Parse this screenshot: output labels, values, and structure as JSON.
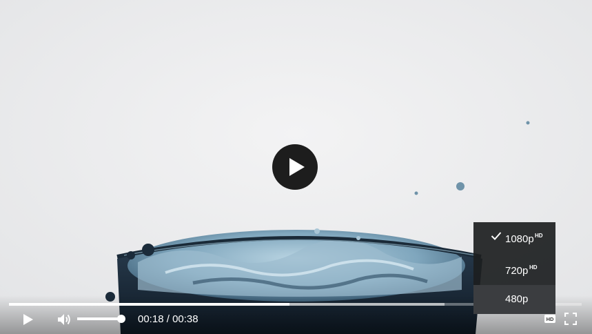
{
  "player": {
    "current_time": "00:18",
    "separator": "/",
    "duration": "00:38",
    "played_fraction": 0.49,
    "buffered_fraction": 0.76,
    "volume_fraction": 1.0
  },
  "quality_menu": {
    "options": [
      {
        "label": "1080p",
        "badge": "HD",
        "selected": true
      },
      {
        "label": "720p",
        "badge": "HD",
        "selected": false
      },
      {
        "label": "480p",
        "badge": "",
        "selected": false
      }
    ]
  },
  "icons": {
    "big_play": "play-icon",
    "play": "play-icon",
    "volume": "volume-icon",
    "quality": "hd-icon",
    "fullscreen": "fullscreen-icon",
    "check": "check-icon"
  },
  "colors": {
    "controls": "#ffffff",
    "menu_bg": "#1c1e20",
    "menu_hover": "#3b3d40",
    "big_play_bg": "#1d1d1d"
  }
}
